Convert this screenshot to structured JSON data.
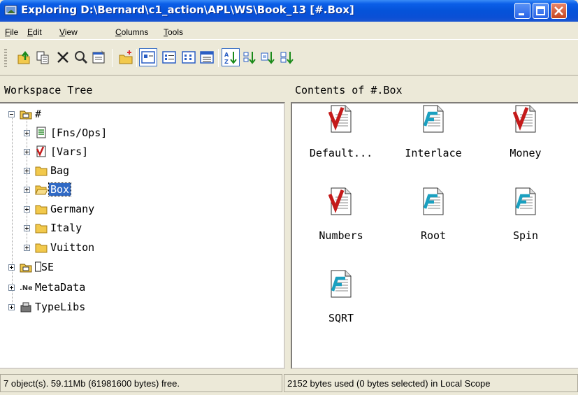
{
  "window": {
    "title": "Exploring D:\\Bernard\\c1_action\\APL\\WS\\Book_13 [#.Box]",
    "colors": {
      "titlebar": "#0553d9",
      "selection": "#316ac5",
      "close": "#c6461f",
      "face": "#ece9d8"
    }
  },
  "menu": [
    {
      "label_pre": "",
      "label_u": "F",
      "label_post": "ile"
    },
    {
      "label_pre": "",
      "label_u": "E",
      "label_post": "dit"
    },
    {
      "label_pre": "",
      "label_u": "V",
      "label_post": "iew"
    },
    {
      "label_pre": "",
      "label_u": "C",
      "label_post": "olumns"
    },
    {
      "label_pre": "",
      "label_u": "T",
      "label_post": "ools"
    }
  ],
  "toolbar": {
    "buttons": [
      "up-folder-icon",
      "copy-icon",
      "delete-icon",
      "find-icon",
      "properties-icon",
      "new-folder-icon",
      "large-icons-view-icon",
      "small-icons-view-icon",
      "list-view-icon",
      "details-view-icon",
      "sort-by-name-icon",
      "sort-by-type-icon",
      "sort-by-size-icon",
      "sort-by-date-icon"
    ]
  },
  "tree_header": "Workspace Tree",
  "contents_header": "Contents of #.Box",
  "tree": {
    "root": "#",
    "fns": "[Fns/Ops]",
    "vars": "[Vars]",
    "bag": "Bag",
    "box": "Box",
    "germany": "Germany",
    "italy": "Italy",
    "vuitton": "Vuitton",
    "ose": "⎕SE",
    "metadata": "MetaData",
    "typelibs": "TypeLibs"
  },
  "contents": [
    {
      "name": "Default...",
      "kind": "variable"
    },
    {
      "name": "Interlace",
      "kind": "function"
    },
    {
      "name": "Money",
      "kind": "variable"
    },
    {
      "name": "Numbers",
      "kind": "variable"
    },
    {
      "name": "Root",
      "kind": "function"
    },
    {
      "name": "Spin",
      "kind": "function"
    },
    {
      "name": "SQRT",
      "kind": "function"
    }
  ],
  "status": {
    "left": "7 object(s). 59.11Mb (61981600 bytes) free.",
    "right": "2152 bytes used (0 bytes selected)  in Local Scope"
  }
}
